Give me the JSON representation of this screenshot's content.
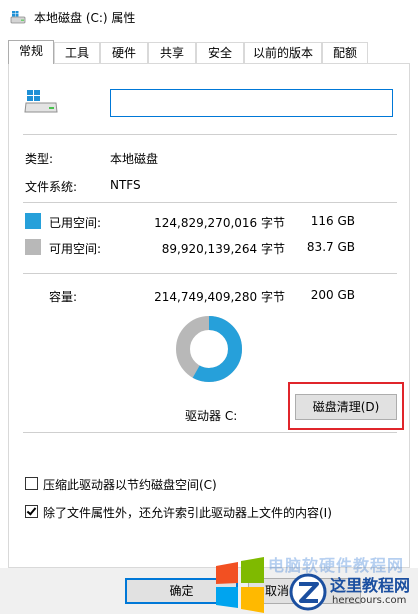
{
  "window": {
    "title": "本地磁盘 (C:) 属性"
  },
  "tabs": [
    {
      "label": "常规",
      "active": true
    },
    {
      "label": "工具"
    },
    {
      "label": "硬件"
    },
    {
      "label": "共享"
    },
    {
      "label": "安全"
    },
    {
      "label": "以前的版本"
    },
    {
      "label": "配额"
    }
  ],
  "general": {
    "name_value": "",
    "type_label": "类型:",
    "type_value": "本地磁盘",
    "fs_label": "文件系统:",
    "fs_value": "NTFS",
    "used": {
      "label": "已用空间:",
      "bytes": "124,829,270,016 字节",
      "size": "116 GB",
      "color": "#26a0da"
    },
    "free": {
      "label": "可用空间:",
      "bytes": "89,920,139,264 字节",
      "size": "83.7 GB",
      "color": "#b8b8b8"
    },
    "capacity": {
      "label": "容量:",
      "bytes": "214,749,409,280 字节",
      "size": "200 GB"
    },
    "drive_label": "驱动器 C:",
    "cleanup_button": "磁盘清理(D)",
    "compress_option": {
      "label": "压缩此驱动器以节约磁盘空间(C)",
      "checked": false
    },
    "index_option": {
      "label": "除了文件属性外，还允许索引此驱动器上文件的内容(I)",
      "checked": true
    }
  },
  "usage": {
    "used_fraction": 0.5813
  },
  "footer": {
    "ok_button": "确定",
    "cancel_button": "取消"
  },
  "watermark": {
    "text": "电脑软硬件教程网",
    "brand": "这里教程网",
    "url": "herecours.com"
  }
}
